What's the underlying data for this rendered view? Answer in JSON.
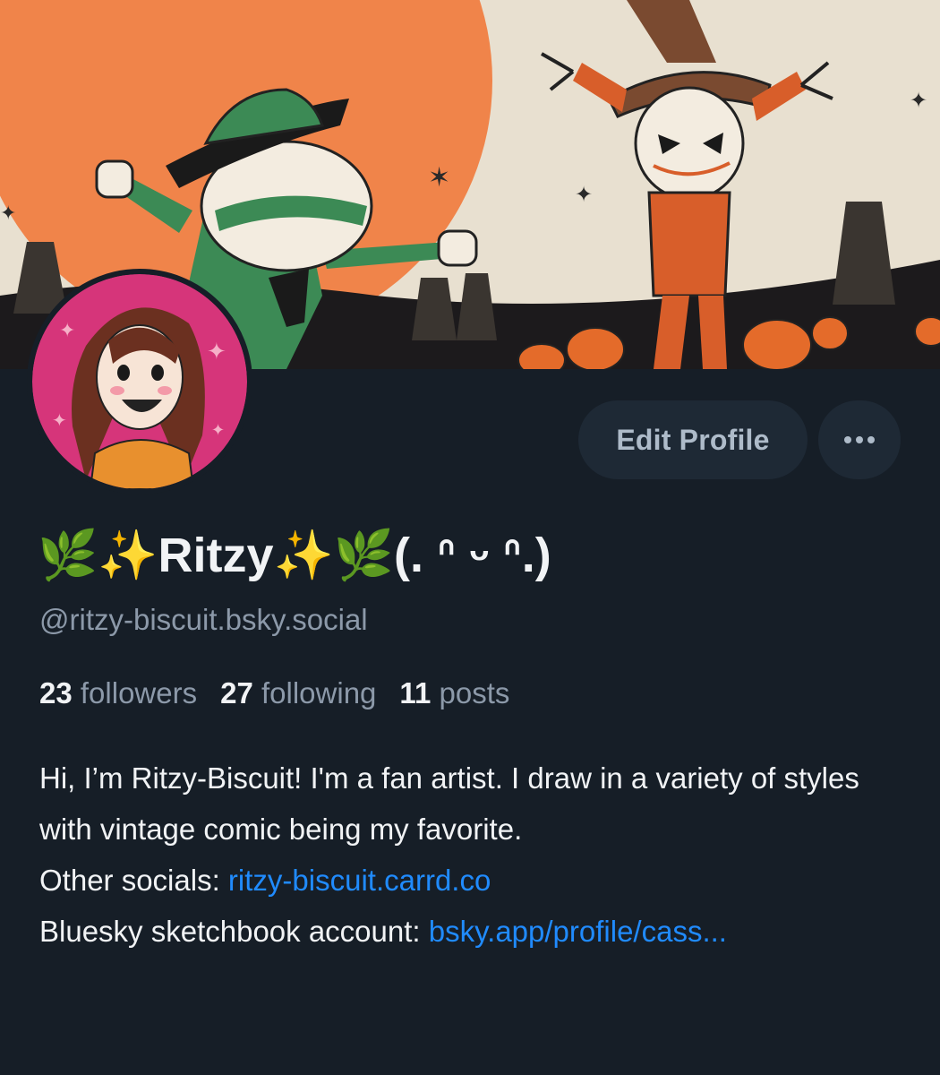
{
  "banner": {
    "description_icon": "banner-image",
    "colors": {
      "paper": "#e8e0d0",
      "moon": "#f0844a",
      "ground": "#1c1a1c",
      "green": "#3c8a55",
      "orange": "#d85e2a"
    }
  },
  "avatar": {
    "icon": "avatar-image"
  },
  "actions": {
    "edit_profile_label": "Edit Profile",
    "more_label": "•••"
  },
  "profile": {
    "display_name_prefix": "🌿✨",
    "display_name": "Ritzy",
    "display_name_suffix": "✨🌿(. ᐢ ᵕ ᐢ.)",
    "handle": "@ritzy-biscuit.bsky.social"
  },
  "stats": {
    "followers_count": "23",
    "followers_label": "followers",
    "following_count": "27",
    "following_label": "following",
    "posts_count": "11",
    "posts_label": "posts"
  },
  "bio": {
    "line1": "Hi, I’m Ritzy-Biscuit! I'm a fan artist. I draw in a variety of styles with vintage comic being my favorite.",
    "other_label": "Other socials: ",
    "other_link": "ritzy-biscuit.carrd.co",
    "sketch_label": "Bluesky sketchbook account: ",
    "sketch_link": "bsky.app/profile/cass..."
  },
  "accent_color": "#208bfe"
}
